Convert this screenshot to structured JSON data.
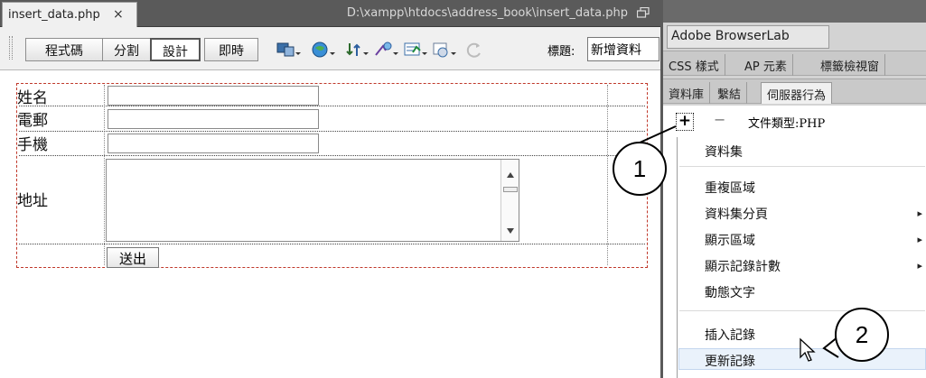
{
  "document_tab": {
    "filename": "insert_data.php",
    "close_glyph": "×",
    "path": "D:\\xampp\\htdocs\\address_book\\insert_data.php"
  },
  "toolbar": {
    "view_buttons": [
      "程式碼",
      "分割",
      "設計",
      "即時"
    ],
    "active_view": "設計",
    "title_label": "標題:",
    "title_value": "新增資料"
  },
  "form": {
    "labels": [
      "姓名",
      "電郵",
      "手機",
      "地址"
    ],
    "submit_label": "送出"
  },
  "right_panel": {
    "browserlab_title": "Adobe BrowserLab",
    "tabs_row1": [
      "CSS 樣式",
      "AP 元素",
      "標籤檢視窗"
    ],
    "tabs_row2": [
      "資料庫",
      "繫結",
      "伺服器行為"
    ],
    "active_tab_row2": "伺服器行為",
    "plus_glyph": "+",
    "minus_glyph": "−",
    "doctype_label": "文件類型:PHP"
  },
  "menu": {
    "items": [
      {
        "label": "資料集",
        "submenu": false
      },
      {
        "label": "重複區域",
        "submenu": false
      },
      {
        "label": "資料集分頁",
        "submenu": true
      },
      {
        "label": "顯示區域",
        "submenu": true
      },
      {
        "label": "顯示記錄計數",
        "submenu": true
      },
      {
        "label": "動態文字",
        "submenu": false
      },
      {
        "label": "插入記錄",
        "submenu": false,
        "highlighted": true
      },
      {
        "label": "更新記錄",
        "submenu": false
      }
    ],
    "submenu_arrow": "▸"
  },
  "callouts": [
    "1",
    "2"
  ],
  "colors": {
    "tabbar_bg": "#5a5a5a",
    "form_border": "#c0392b",
    "panel_bg": "#d3d3d3",
    "menu_highlight": "#eaf2fb"
  }
}
